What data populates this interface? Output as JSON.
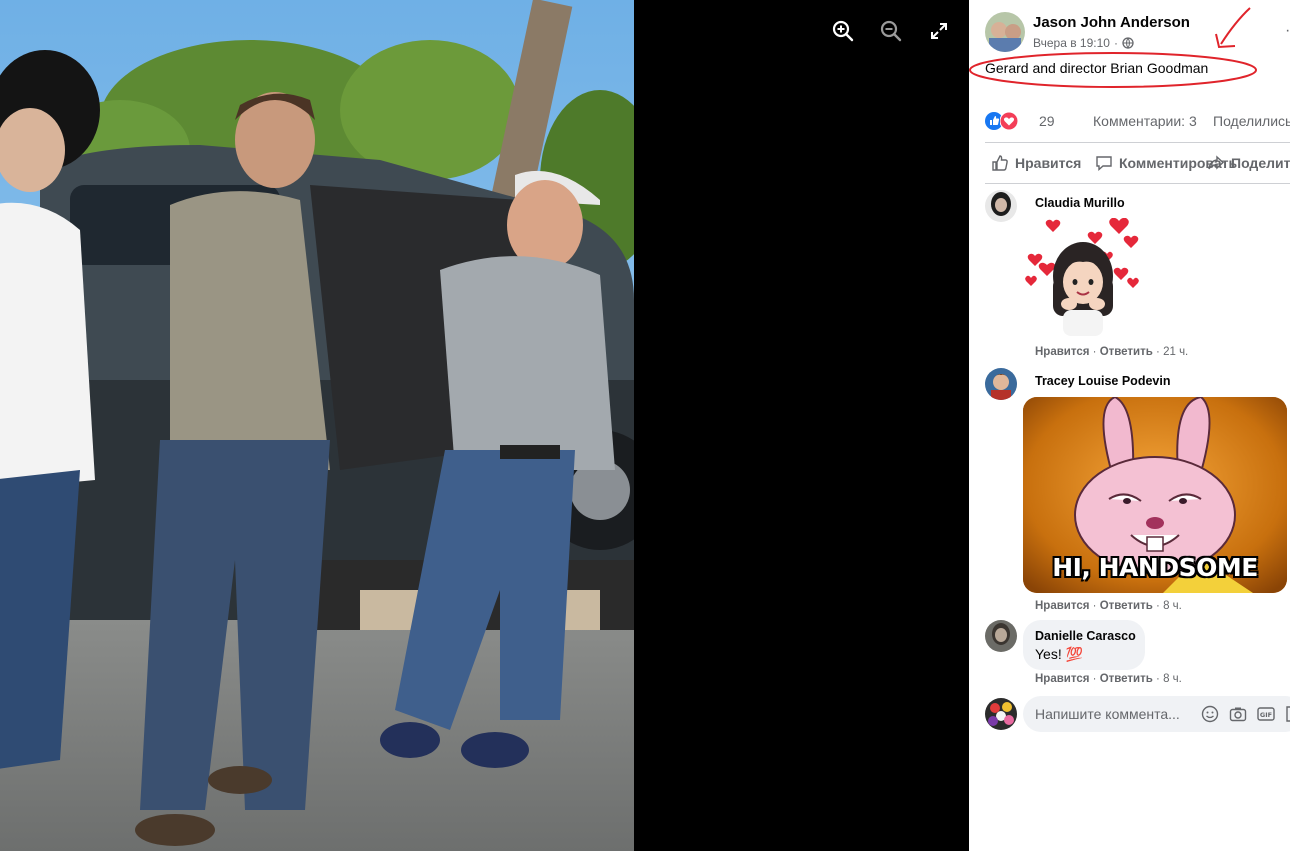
{
  "viewer": {
    "zoom_in_icon": "magnifier-plus-icon",
    "zoom_out_icon": "magnifier-minus-icon",
    "fullscreen_icon": "expand-arrows-icon"
  },
  "post": {
    "author": "Jason John Anderson",
    "timestamp": "Вчера в 19:10",
    "privacy_icon": "globe-icon",
    "more_icon": "ellipsis-icon",
    "caption": "Gerard and director Brian Goodman"
  },
  "reactions": {
    "types": [
      "like",
      "love"
    ],
    "count": "29",
    "comments": "Комментарии: 3",
    "shares": "Поделились"
  },
  "actions": {
    "like": "Нравится",
    "comment": "Комментировать",
    "share": "Поделиться"
  },
  "comments": [
    {
      "name": "Claudia Murillo",
      "sticker": "avatar-with-hearts-sticker",
      "like": "Нравится",
      "reply": "Ответить",
      "time": "21 ч."
    },
    {
      "name": "Tracey Louise Podevin",
      "gif_caption": "HI, HANDSOME",
      "like": "Нравится",
      "reply": "Ответить",
      "time": "8 ч."
    },
    {
      "name": "Danielle Carasco",
      "text": "Yes! 💯",
      "like": "Нравится",
      "reply": "Ответить",
      "time": "8 ч."
    }
  ],
  "composer": {
    "placeholder": "Напишите коммента...",
    "icons": [
      "emoji-icon",
      "camera-icon",
      "gif-icon",
      "sticker-icon"
    ]
  },
  "colors": {
    "panel_bg": "#ffffff",
    "bubble_bg": "#f0f2f5",
    "secondary_text": "#65676b",
    "like_blue": "#1877f2",
    "love_red": "#f33e58",
    "annotation_red": "#e0242b",
    "sky": "#7fb9e8",
    "tree": "#5d8a33"
  }
}
